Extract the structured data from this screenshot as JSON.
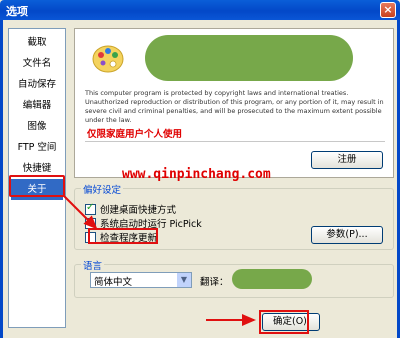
{
  "window": {
    "title": "选项",
    "close_glyph": "×"
  },
  "sidebar": {
    "items": [
      {
        "label": "截取"
      },
      {
        "label": "文件名"
      },
      {
        "label": "自动保存"
      },
      {
        "label": "编辑器"
      },
      {
        "label": "图像"
      },
      {
        "label": "FTP 空间"
      },
      {
        "label": "快捷键"
      },
      {
        "label": "关于"
      }
    ],
    "active_index": 7
  },
  "about": {
    "legal_text": "This computer program is protected by copyright laws and international treaties. Unauthorized reproduction or distribution of this program, or any portion of it, may result in severe civil and criminal penalties, and will be prosecuted to the maximum extent possible under the law.",
    "license": "仅限家庭用户个人使用",
    "register_button": "注册"
  },
  "watermark": "www.qinpinchang.com",
  "preferences": {
    "group_title": "偏好设定",
    "options": [
      {
        "label": "创建桌面快捷方式",
        "checked": true
      },
      {
        "label": "系统启动时运行 PicPick",
        "checked": false
      },
      {
        "label": "检查程序更新",
        "checked": false
      }
    ],
    "params_button": "参数(P)..."
  },
  "language": {
    "group_title": "语言",
    "selected": "简体中文",
    "translator_label": "翻译："
  },
  "footer": {
    "ok_button": "确定(O)"
  },
  "colors": {
    "highlight_red": "#e01010",
    "accent_blue": "#0046d5",
    "blob_green": "#77a84a"
  }
}
